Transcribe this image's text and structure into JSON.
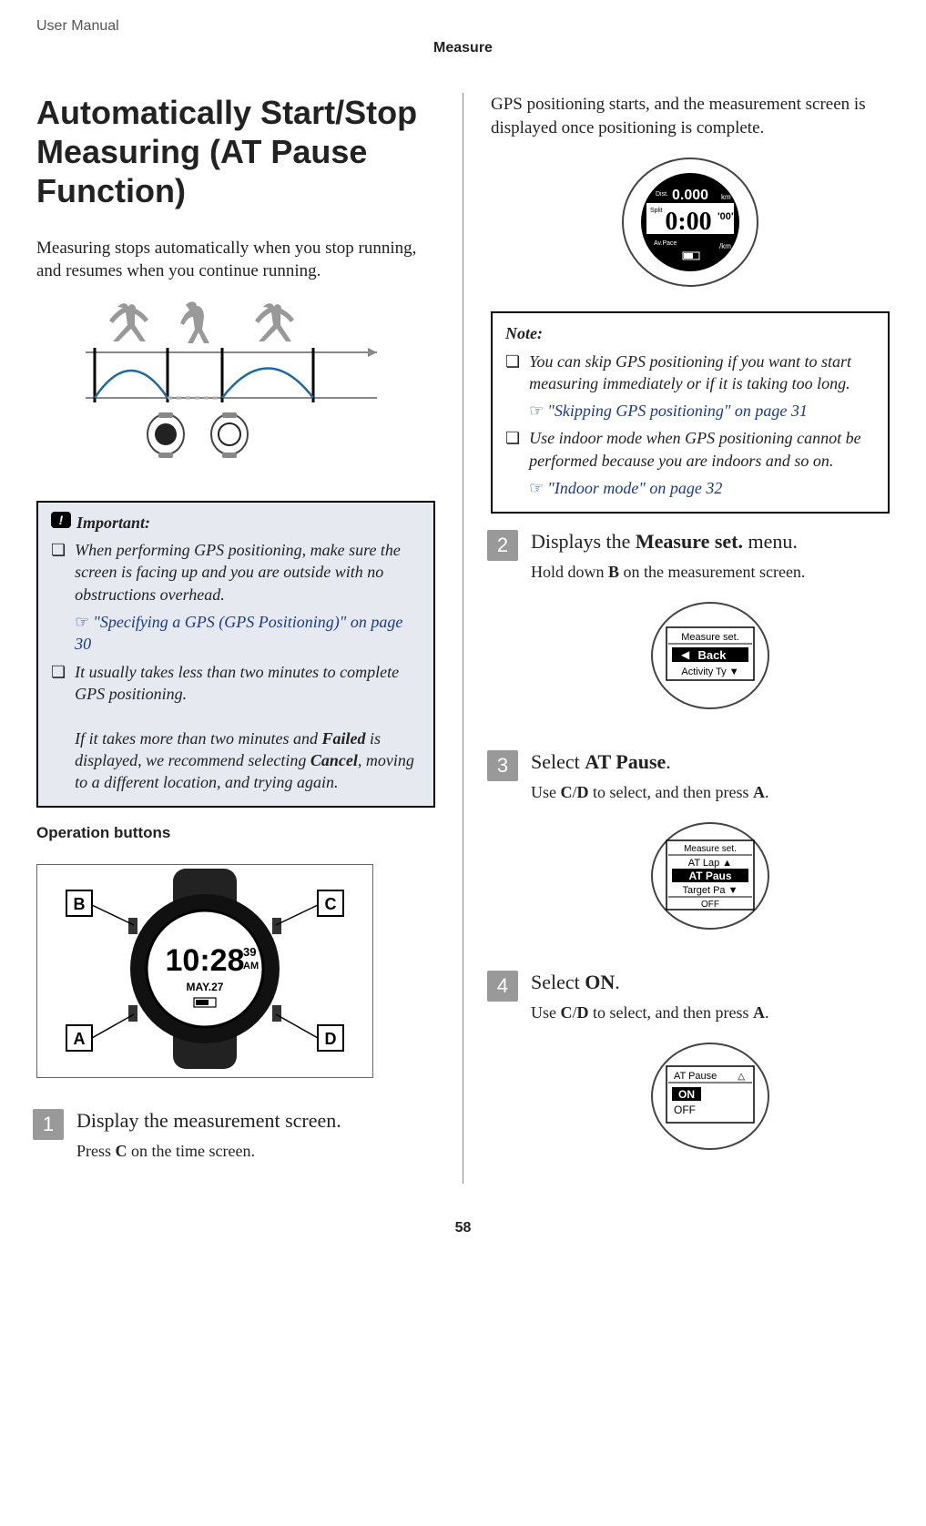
{
  "header": {
    "doc_type": "User Manual",
    "section": "Measure"
  },
  "h1": "Automatically Start/Stop Measuring (AT Pause Function)",
  "intro": "Measuring stops automatically when you stop running, and resumes when you continue running.",
  "important": {
    "title": "Important:",
    "items": [
      {
        "text": "When performing GPS positioning, make sure the screen is facing up and you are outside with no obstructions overhead.",
        "link": "\"Specifying a GPS (GPS Positioning)\" on page 30"
      },
      {
        "text_before": "It usually takes less than two minutes to complete GPS positioning.",
        "text_after_prefix": "If it takes more than two minutes and ",
        "bold1": "Failed",
        "text_mid": " is displayed, we recommend selecting ",
        "bold2": "Cancel",
        "text_end": ", moving to a different location, and trying again."
      }
    ]
  },
  "op_buttons_heading": "Operation buttons",
  "op_buttons_labels": {
    "A": "A",
    "B": "B",
    "C": "C",
    "D": "D"
  },
  "op_buttons_time": "10:28",
  "op_buttons_sec": "39",
  "op_buttons_ampm": "AM",
  "op_buttons_date": "MAY.27",
  "steps": [
    {
      "num": "1",
      "title": "Display the measurement screen.",
      "desc_pre": "Press ",
      "desc_b": "C",
      "desc_post": " on the time screen."
    },
    {
      "num": "2",
      "title_pre": "Displays the ",
      "title_b": "Measure set.",
      "title_post": " menu.",
      "desc_pre": "Hold down ",
      "desc_b": "B",
      "desc_post": " on the measurement screen.",
      "watch_lines": [
        "Measure set.",
        "Back",
        "Activity Ty"
      ]
    },
    {
      "num": "3",
      "title_pre": "Select ",
      "title_b": "AT Pause",
      "title_post": ".",
      "desc_pre": "Use ",
      "desc_b1": "C",
      "desc_mid": "/",
      "desc_b2": "D",
      "desc_mid2": " to select, and then press ",
      "desc_b3": "A",
      "desc_post": ".",
      "watch_lines": [
        "Measure set.",
        "AT Lap",
        "AT Paus",
        "Target Pa",
        "OFF"
      ]
    },
    {
      "num": "4",
      "title_pre": "Select ",
      "title_b": "ON",
      "title_post": ".",
      "desc_pre": "Use ",
      "desc_b1": "C",
      "desc_mid": "/",
      "desc_b2": "D",
      "desc_mid2": " to select, and then press ",
      "desc_b3": "A",
      "desc_post": ".",
      "watch_lines": [
        "AT Pause",
        "ON",
        "OFF"
      ]
    }
  ],
  "gps_text": "GPS positioning starts, and the measurement screen is displayed once positioning is complete.",
  "gps_watch": {
    "dist_label": "Dist.",
    "dist": "0.000",
    "dist_unit": "km",
    "split": "Split",
    "time": "0:00",
    "time_sec": "'00\"",
    "avpace": "Av.Pace",
    "pace_unit": "/km"
  },
  "note": {
    "title": "Note:",
    "items": [
      {
        "text": "You can skip GPS positioning if you want to start measuring immediately or if it is taking too long.",
        "link": "\"Skipping GPS positioning\" on page 31"
      },
      {
        "text": "Use indoor mode when GPS positioning cannot be performed because you are indoors and so on.",
        "link": "\"Indoor mode\" on page 32"
      }
    ]
  },
  "page_num": "58"
}
